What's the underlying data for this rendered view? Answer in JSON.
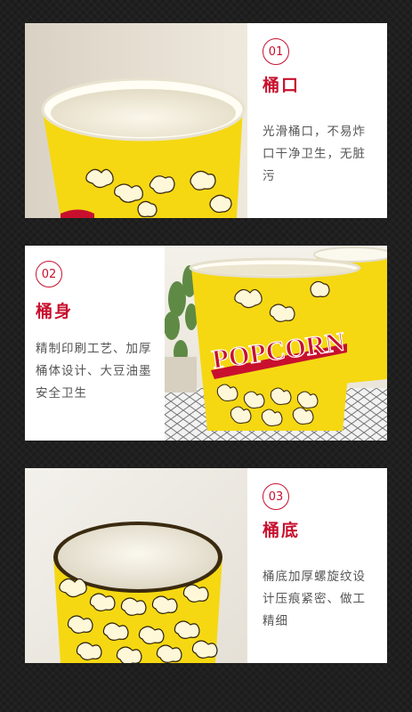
{
  "sections": [
    {
      "number": "01",
      "title": "桶口",
      "description": "光滑桶口，不易炸口干净卫生，无脏污"
    },
    {
      "number": "02",
      "title": "桶身",
      "description": "精制印刷工艺、加厚桶体设计、大豆油墨安全卫生"
    },
    {
      "number": "03",
      "title": "桶底",
      "description": "桶底加厚螺旋纹设计压痕紧密、做工精细"
    }
  ],
  "photo": {
    "brand_text": "POPCORN"
  },
  "colors": {
    "accent": "#c8102e",
    "cup_yellow": "#f5d812",
    "background": "#1f1f1f"
  }
}
